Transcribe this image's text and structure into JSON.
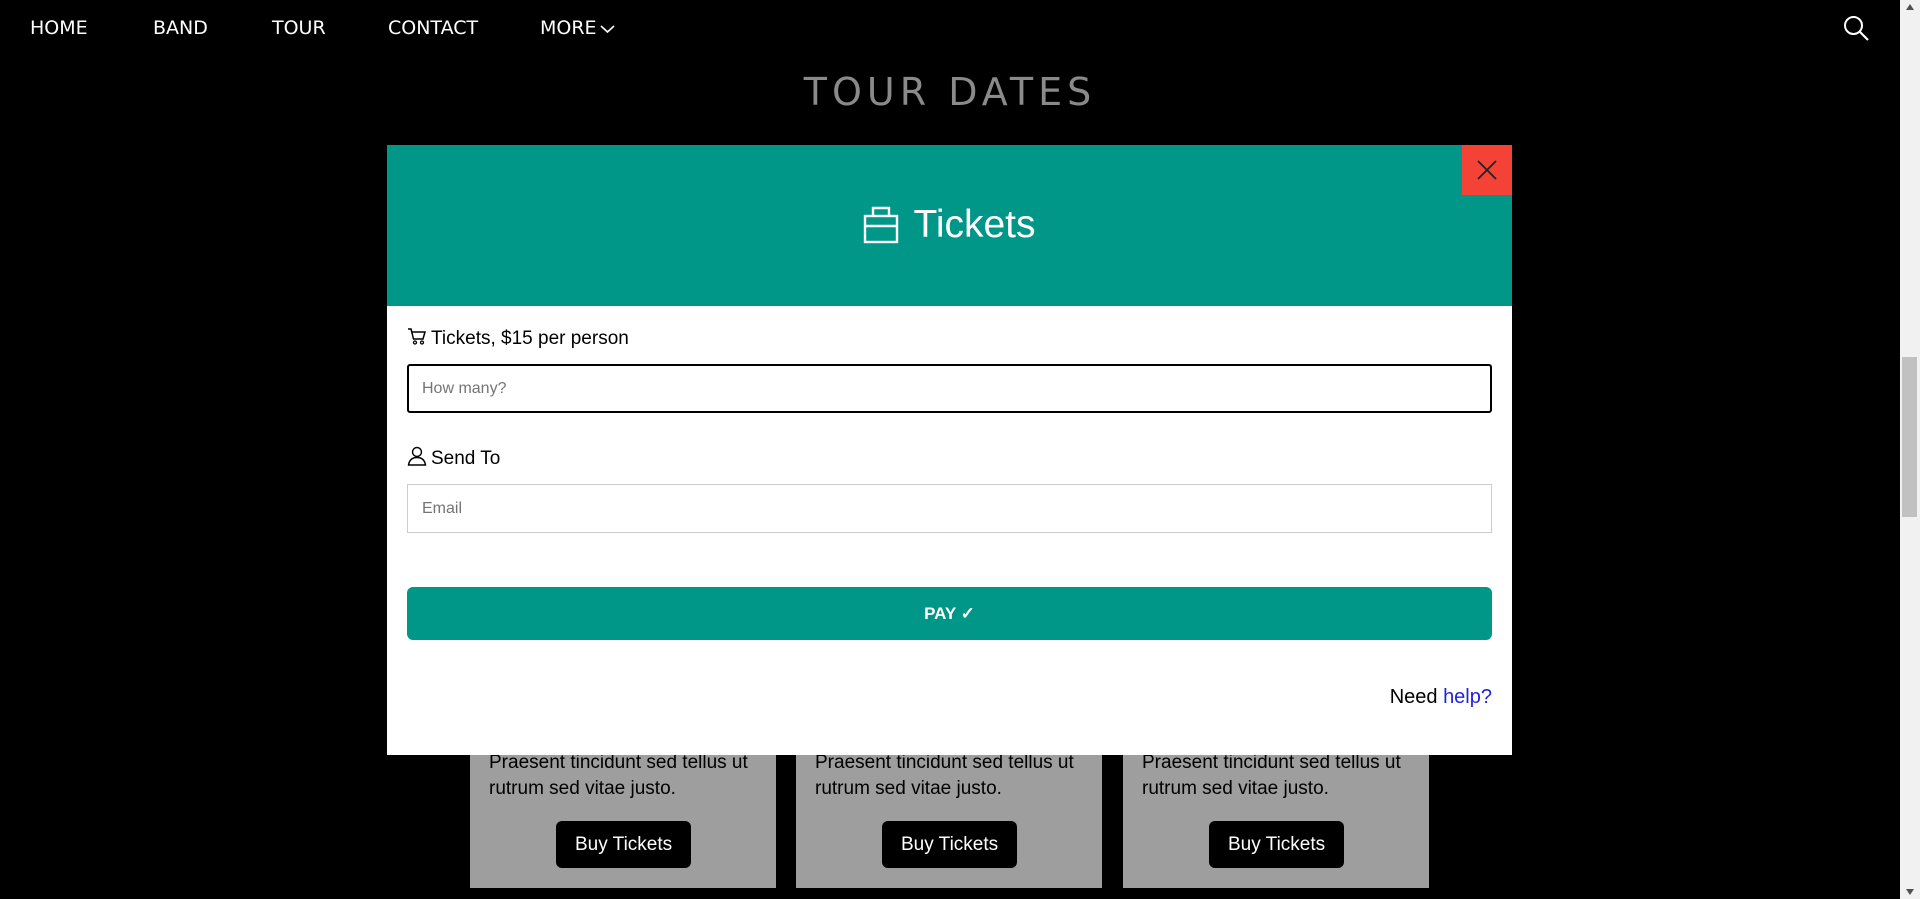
{
  "nav": {
    "items": [
      "HOME",
      "BAND",
      "TOUR",
      "CONTACT"
    ],
    "more_label": "MORE",
    "search_icon": "search-icon"
  },
  "page": {
    "section_title": "TOUR DATES",
    "cards": [
      {
        "text": "Praesent tincidunt sed tellus ut rutrum sed vitae justo.",
        "button": "Buy Tickets"
      },
      {
        "text": "Praesent tincidunt sed tellus ut rutrum sed vitae justo.",
        "button": "Buy Tickets"
      },
      {
        "text": "Praesent tincidunt sed tellus ut rutrum sed vitae justo.",
        "button": "Buy Tickets"
      }
    ]
  },
  "modal": {
    "title": "Tickets",
    "title_icon": "briefcase-icon",
    "close_icon": "close-icon",
    "tickets_label": "Tickets, $15 per person",
    "tickets_icon": "shopping-cart-icon",
    "tickets_placeholder": "How many?",
    "send_label": "Send To",
    "send_icon": "user-icon",
    "email_placeholder": "Email",
    "pay_label": "PAY ✓",
    "help_text": "Need",
    "help_link": "help?"
  },
  "colors": {
    "accent": "#009688",
    "close": "#f44336",
    "link": "#2222dd",
    "card": "#9e9e9e"
  }
}
